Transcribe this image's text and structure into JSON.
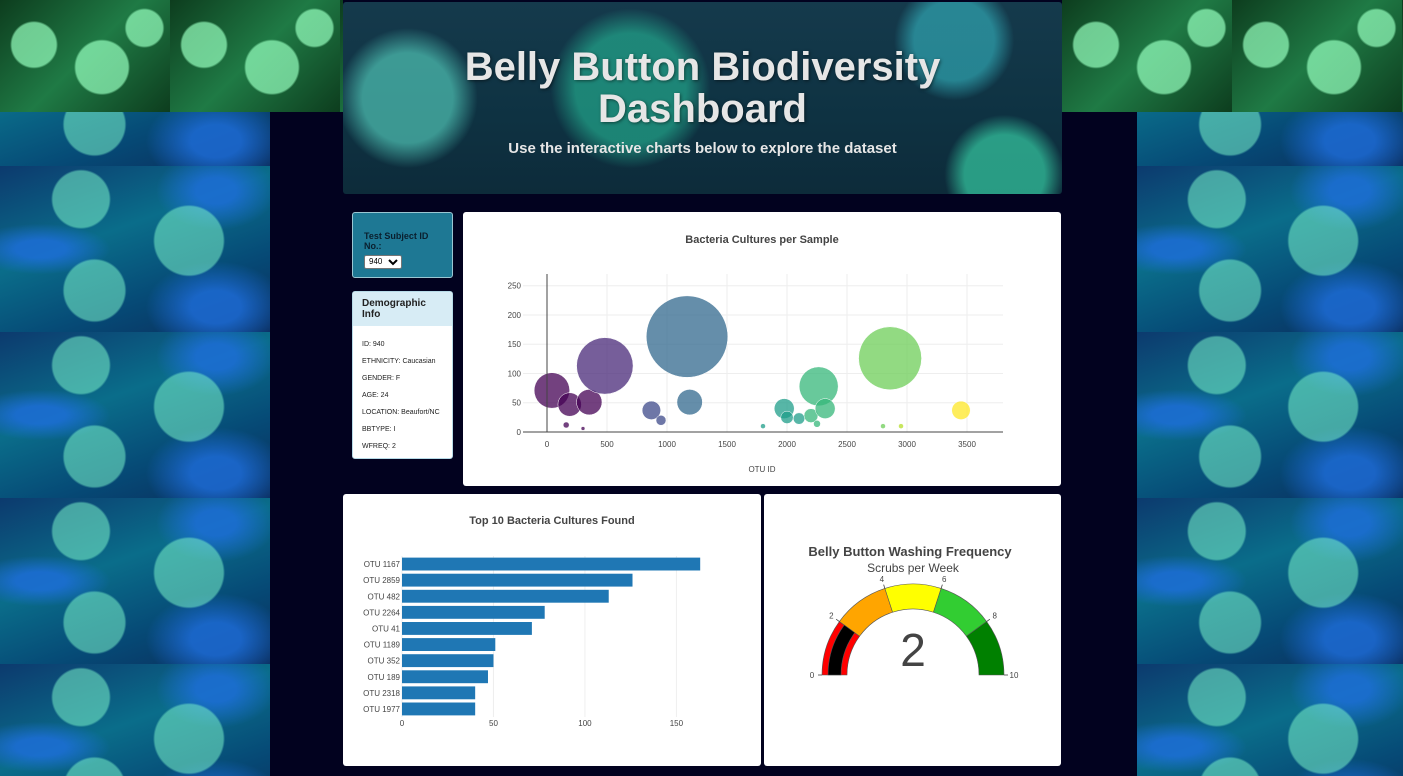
{
  "header": {
    "title": "Belly Button Biodiversity Dashboard",
    "subtitle": "Use the interactive charts below to explore the dataset"
  },
  "selector": {
    "label": "Test Subject ID No.:",
    "selected": "940"
  },
  "demographics": {
    "heading": "Demographic Info",
    "lines": [
      "ID: 940",
      "ETHNICITY: Caucasian",
      "GENDER: F",
      "AGE: 24",
      "LOCATION: Beaufort/NC",
      "BBTYPE: I",
      "WFREQ: 2"
    ]
  },
  "colors": {
    "page_background": "#02021f",
    "selector_panel": "#1e7894",
    "bar": "#1f77b4",
    "gauge_steps": [
      "#000000",
      "#ff0000",
      "#ffa500",
      "#ffff00",
      "#32cd32",
      "#008000"
    ]
  },
  "chart_data": [
    {
      "type": "scatter",
      "variant": "bubble",
      "title": "Bacteria Cultures per Sample",
      "xlabel": "OTU ID",
      "ylabel": "",
      "xlim": [
        -200,
        3800
      ],
      "ylim": [
        0,
        270
      ],
      "xticks": [
        "0",
        "500",
        "1000",
        "1500",
        "2000",
        "2500",
        "3000",
        "3500"
      ],
      "yticks": [
        "0",
        "50",
        "100",
        "150",
        "200",
        "250"
      ],
      "grid": true,
      "colorscale": "Viridis",
      "points": [
        {
          "x": 41,
          "y": 71
        },
        {
          "x": 189,
          "y": 47
        },
        {
          "x": 352,
          "y": 51
        },
        {
          "x": 482,
          "y": 113
        },
        {
          "x": 1167,
          "y": 163
        },
        {
          "x": 1189,
          "y": 51
        },
        {
          "x": 870,
          "y": 37
        },
        {
          "x": 950,
          "y": 20
        },
        {
          "x": 160,
          "y": 12
        },
        {
          "x": 300,
          "y": 6
        },
        {
          "x": 1977,
          "y": 40
        },
        {
          "x": 2000,
          "y": 25
        },
        {
          "x": 2100,
          "y": 23
        },
        {
          "x": 2200,
          "y": 28
        },
        {
          "x": 2264,
          "y": 78
        },
        {
          "x": 2318,
          "y": 40
        },
        {
          "x": 2250,
          "y": 14
        },
        {
          "x": 1800,
          "y": 10
        },
        {
          "x": 2859,
          "y": 126
        },
        {
          "x": 2800,
          "y": 10
        },
        {
          "x": 2950,
          "y": 10
        },
        {
          "x": 3450,
          "y": 37
        }
      ]
    },
    {
      "type": "bar",
      "orientation": "horizontal",
      "title": "Top 10 Bacteria Cultures Found",
      "xlabel": "",
      "ylabel": "",
      "xlim": [
        0,
        170
      ],
      "xticks": [
        "0",
        "50",
        "100",
        "150"
      ],
      "categories": [
        "OTU 1167",
        "OTU 2859",
        "OTU 482",
        "OTU 2264",
        "OTU 41",
        "OTU 1189",
        "OTU 352",
        "OTU 189",
        "OTU 2318",
        "OTU 1977"
      ],
      "values": [
        163,
        126,
        113,
        78,
        71,
        51,
        50,
        47,
        40,
        40
      ]
    },
    {
      "type": "gauge",
      "title": "Belly Button Washing Frequency",
      "subtitle": "Scrubs per Week",
      "value": "2",
      "range": [
        0,
        10
      ],
      "tick_labels": [
        "0",
        "2",
        "4",
        "6",
        "8",
        "10"
      ]
    }
  ]
}
